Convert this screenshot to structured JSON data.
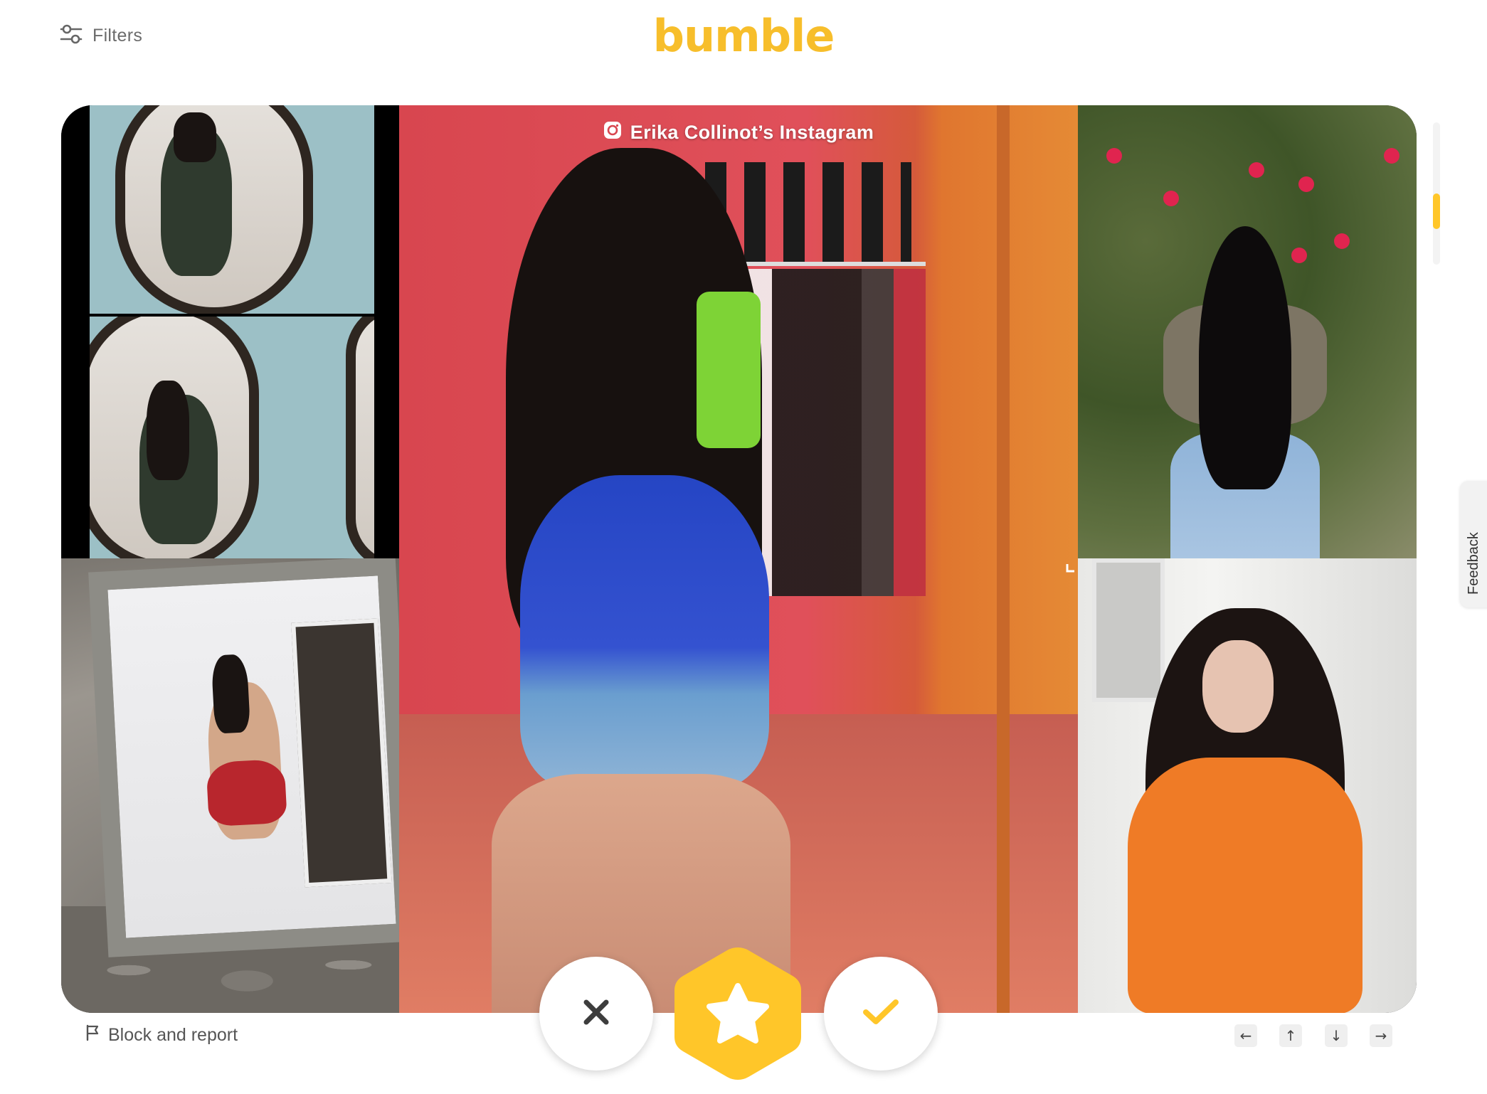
{
  "header": {
    "filters_label": "Filters",
    "logo_text": "bumble"
  },
  "profile": {
    "instagram_title": "Erika Collinot’s Instagram"
  },
  "actions": {
    "pass_icon": "close-icon",
    "superswipe_icon": "star-icon",
    "like_icon": "check-icon"
  },
  "footer": {
    "block_report_label": "Block and report",
    "keys": [
      "←",
      "↑",
      "↓",
      "→"
    ]
  },
  "feedback_label": "Feedback",
  "colors": {
    "brand": "#FFC629",
    "logo": "#F7BE2B",
    "icon_dark": "#3d3d3d"
  }
}
